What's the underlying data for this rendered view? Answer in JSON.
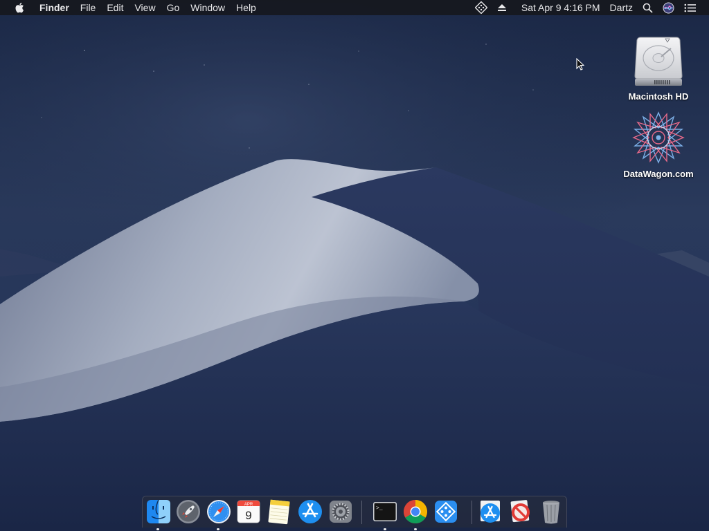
{
  "menubar": {
    "app_name": "Finder",
    "menus": [
      "File",
      "Edit",
      "View",
      "Go",
      "Window",
      "Help"
    ],
    "status": {
      "clock": "Sat Apr 9  4:16 PM",
      "user": "Dartz"
    }
  },
  "desktop_icons": [
    {
      "label": "Macintosh HD",
      "icon": "hard-drive-icon"
    },
    {
      "label": "DataWagon.com",
      "icon": "mandala-star-icon"
    }
  ],
  "dock": {
    "items": [
      {
        "name": "Finder",
        "icon": "finder-icon"
      },
      {
        "name": "Launchpad",
        "icon": "rocket-icon"
      },
      {
        "name": "Safari",
        "icon": "compass-icon"
      },
      {
        "name": "Calendar",
        "icon": "calendar-icon",
        "month": "APR",
        "day": "9"
      },
      {
        "name": "Notes",
        "icon": "notepad-icon"
      },
      {
        "name": "App Store",
        "icon": "app-store-icon"
      },
      {
        "name": "System Preferences",
        "icon": "gear-icon"
      },
      {
        "name": "Terminal",
        "icon": "terminal-icon",
        "prompt": ">_"
      },
      {
        "name": "Google Chrome",
        "icon": "chrome-icon"
      },
      {
        "name": "TeamViewer-like",
        "icon": "diamond-dots-icon"
      },
      {
        "name": "App Store Downloads",
        "icon": "app-store-icon"
      },
      {
        "name": "Blocked App",
        "icon": "prohibited-icon"
      },
      {
        "name": "Trash",
        "icon": "trash-icon"
      }
    ]
  },
  "colors": {
    "accent_blue": "#1e88f0",
    "menubar_bg": "#16181e",
    "sky_top": "#1c2a48",
    "dune_light": "#9aa3b8"
  }
}
